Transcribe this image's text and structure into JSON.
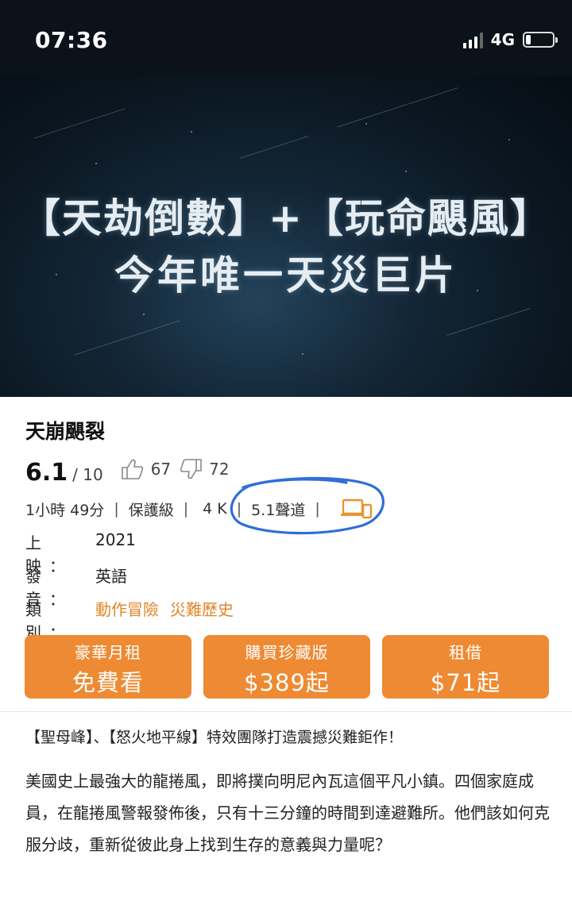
{
  "status_bar": {
    "time": "07:36",
    "network": "4G",
    "battery_level": 0.2
  },
  "banner": {
    "line1": "【天劫倒數】+【玩命颶風】",
    "line2": "今年唯一天災巨片"
  },
  "movie": {
    "title": "天崩颶裂",
    "score": "6.1",
    "score_max": "/ 10",
    "likes": "67",
    "dislikes": "72",
    "duration": "1小時 49分",
    "rating": "保護級",
    "resolution": "4 K",
    "audio": "5.1聲道",
    "release_label": "上 映：",
    "release_year": "2021",
    "language_label": "發 音：",
    "language": "英語",
    "genre_label": "類 別：",
    "genres": [
      "動作冒險",
      "災難歷史"
    ]
  },
  "buttons": [
    {
      "small": "豪華月租",
      "big": "免費看"
    },
    {
      "small": "購買珍藏版",
      "big": "$389起"
    },
    {
      "small": "租借",
      "big": "$71起"
    }
  ],
  "description": {
    "tagline": "【聖母峰】、【怒火地平線】特效團隊打造震撼災難鉅作！",
    "body": "美國史上最強大的龍捲風，即將撲向明尼內瓦這個平凡小鎮。四個家庭成員，在龍捲風警報發佈後，只有十三分鐘的時間到達避難所。他們該如何克服分歧，重新從彼此身上找到生存的意義與力量呢？"
  },
  "colors": {
    "accent": "#ee8a33",
    "genre_text": "#e0862a",
    "annotation_circle": "#2f6fd6"
  }
}
